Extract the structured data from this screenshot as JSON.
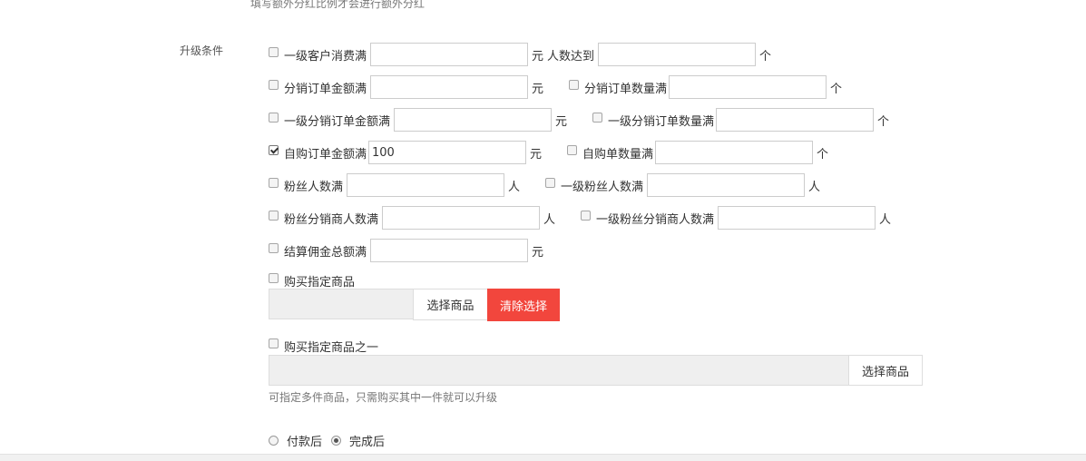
{
  "hint_top": "填写额外分红比例才会进行额外分红",
  "section_label": "升级条件",
  "row1": {
    "label": "一级客户消费满",
    "value": "",
    "unit": "元",
    "label2": "人数达到",
    "value2": "",
    "unit2": "个"
  },
  "row2": {
    "label": "分销订单金额满",
    "value": "",
    "unit": "元",
    "label2": "分销订单数量满",
    "value2": "",
    "unit2": "个"
  },
  "row3": {
    "label": "一级分销订单金额满",
    "value": "",
    "unit": "元",
    "label2": "一级分销订单数量满",
    "value2": "",
    "unit2": "个"
  },
  "row4": {
    "label": "自购订单金额满",
    "value": "100",
    "unit": "元",
    "label2": "自购单数量满",
    "value2": "",
    "unit2": "个"
  },
  "row5": {
    "label": "粉丝人数满",
    "value": "",
    "unit": "人",
    "label2": "一级粉丝人数满",
    "value2": "",
    "unit2": "人"
  },
  "row6": {
    "label": "粉丝分销商人数满",
    "value": "",
    "unit": "人",
    "label2": "一级粉丝分销商人数满",
    "value2": "",
    "unit2": "人"
  },
  "row7": {
    "label": "结算佣金总额满",
    "value": "",
    "unit": "元"
  },
  "goods_specific": {
    "label": "购买指定商品",
    "select_button": "选择商品",
    "clear_button": "清除选择"
  },
  "goods_one_of": {
    "label": "购买指定商品之一",
    "select_button": "选择商品",
    "note": "可指定多件商品，只需购买其中一件就可以升级"
  },
  "timing": {
    "option1": "付款后",
    "option2": "完成后",
    "selected": "完成后"
  },
  "colors": {
    "danger": "#f2463d",
    "input_border": "#cccccc",
    "box_bg": "#efefef"
  }
}
